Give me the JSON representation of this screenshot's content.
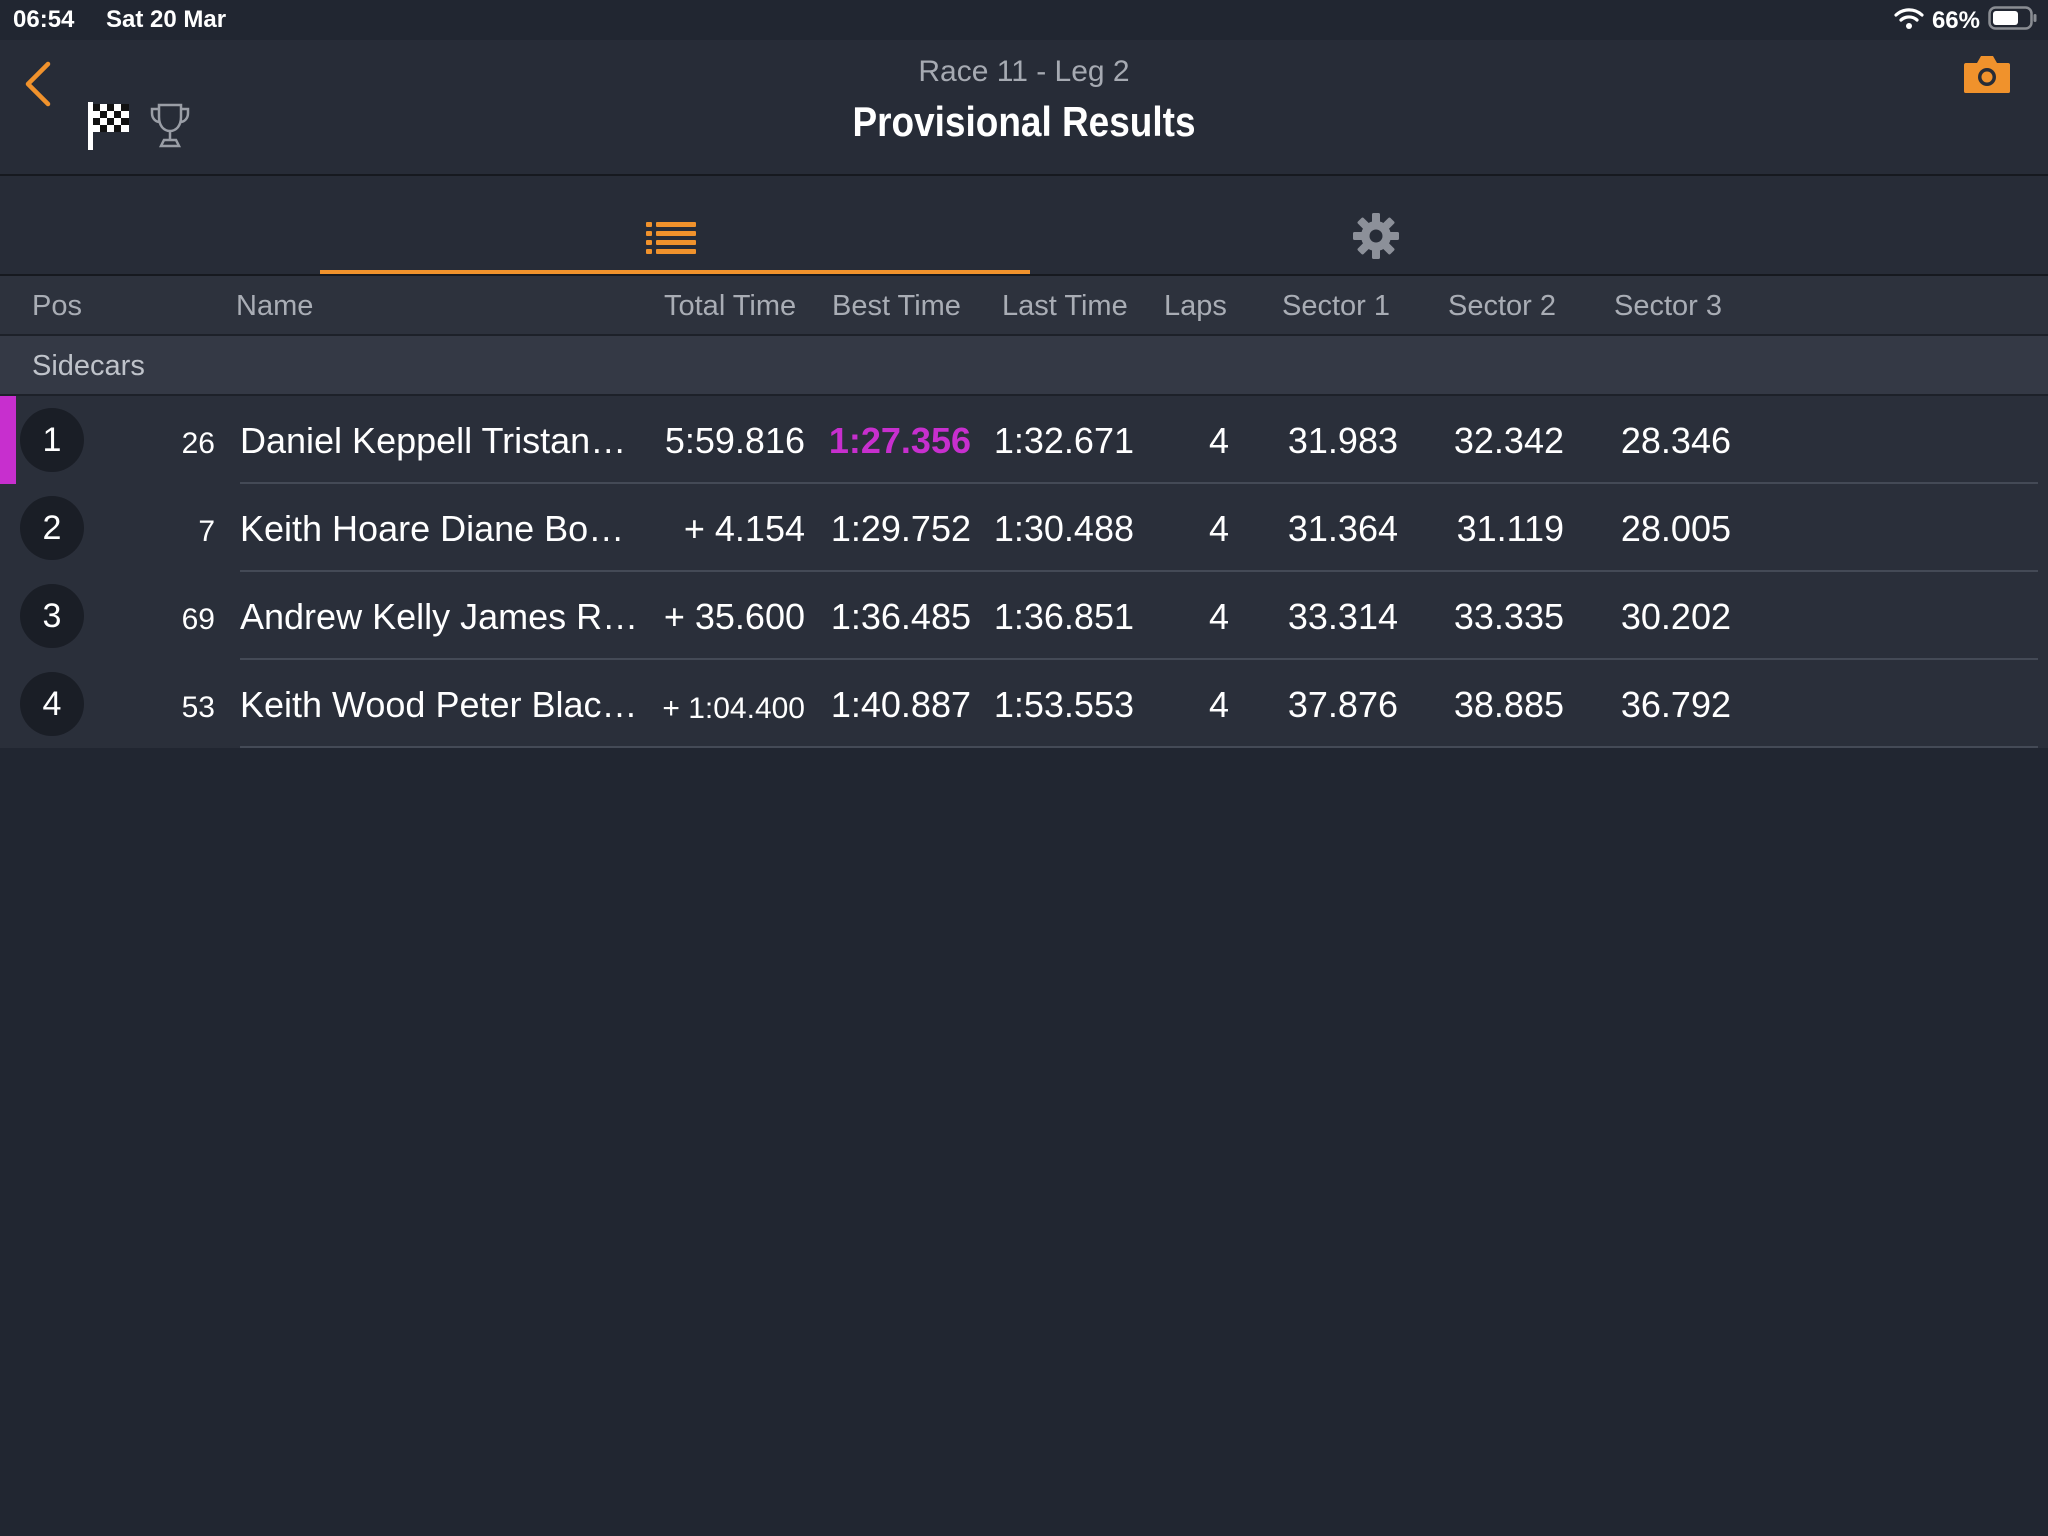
{
  "status_bar": {
    "time": "06:54",
    "date": "Sat 20 Mar",
    "battery": "66%"
  },
  "header": {
    "subtitle": "Race 11 - Leg 2",
    "title": "Provisional Results",
    "accent_color": "#f0922c"
  },
  "tabs": [
    {
      "icon": "list-icon",
      "active": true
    },
    {
      "icon": "gear-icon",
      "active": false
    }
  ],
  "columns": {
    "pos": "Pos",
    "name": "Name",
    "total_time": "Total Time",
    "best_time": "Best Time",
    "last_time": "Last Time",
    "laps": "Laps",
    "sector1": "Sector 1",
    "sector2": "Sector 2",
    "sector3": "Sector 3"
  },
  "group_label": "Sidecars",
  "fastest_color": "#c72fce",
  "results": [
    {
      "pos": "1",
      "number": "26",
      "name": "Daniel Keppell Tristan…",
      "total": "5:59.816",
      "best": "1:27.356",
      "last": "1:32.671",
      "laps": "4",
      "s1": "31.983",
      "s2": "32.342",
      "s3": "28.346",
      "fastest": true,
      "leader": true
    },
    {
      "pos": "2",
      "number": "7",
      "name": "Keith Hoare Diane Bo…",
      "total": "+ 4.154",
      "best": "1:29.752",
      "last": "1:30.488",
      "laps": "4",
      "s1": "31.364",
      "s2": "31.119",
      "s3": "28.005",
      "fastest": false,
      "leader": false
    },
    {
      "pos": "3",
      "number": "69",
      "name": "Andrew Kelly James R…",
      "total": "+ 35.600",
      "best": "1:36.485",
      "last": "1:36.851",
      "laps": "4",
      "s1": "33.314",
      "s2": "33.335",
      "s3": "30.202",
      "fastest": false,
      "leader": false
    },
    {
      "pos": "4",
      "number": "53",
      "name": "Keith Wood Peter Blac…",
      "total": "+ 1:04.400",
      "best": "1:40.887",
      "last": "1:53.553",
      "laps": "4",
      "s1": "37.876",
      "s2": "38.885",
      "s3": "36.792",
      "fastest": false,
      "leader": false
    }
  ]
}
